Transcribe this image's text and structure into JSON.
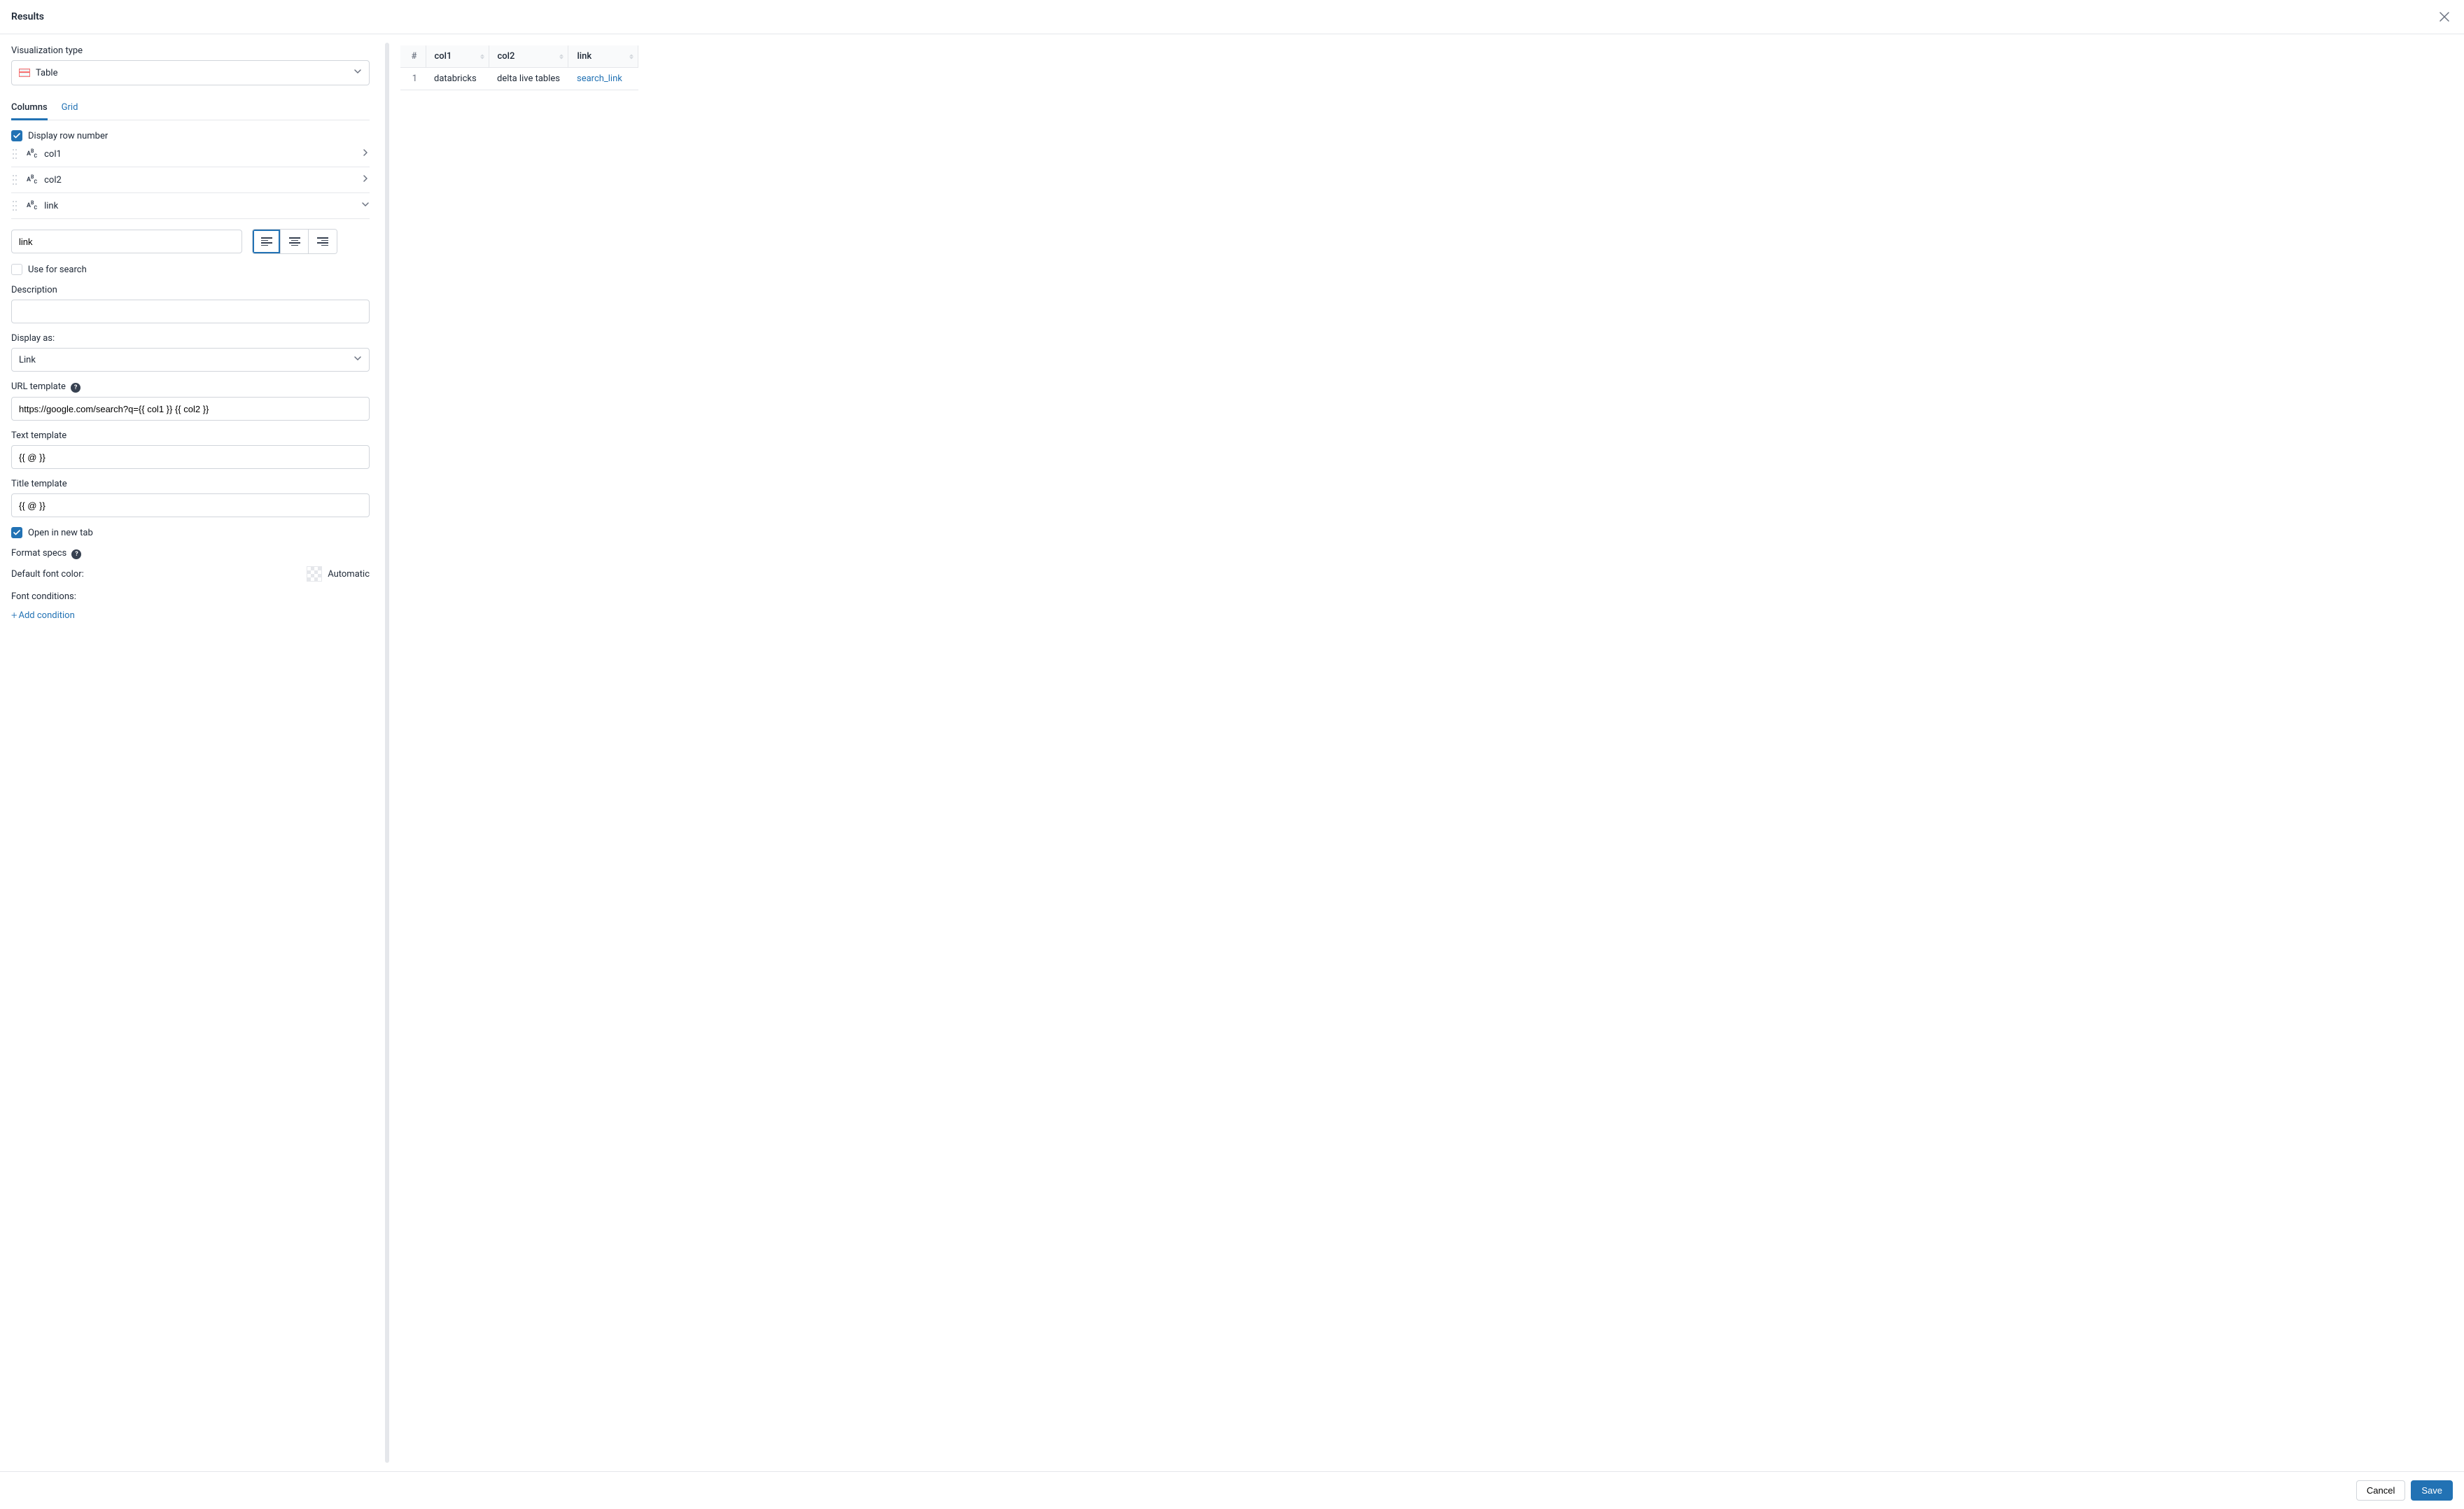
{
  "header": {
    "title": "Results"
  },
  "viz": {
    "label": "Visualization type",
    "value": "Table"
  },
  "tabs": {
    "columns": "Columns",
    "grid": "Grid",
    "active": "columns"
  },
  "displayRowNumber": {
    "label": "Display row number",
    "checked": true
  },
  "columns": [
    {
      "name": "col1",
      "expanded": false
    },
    {
      "name": "col2",
      "expanded": false
    },
    {
      "name": "link",
      "expanded": true
    }
  ],
  "linkConfig": {
    "nameInput": "link",
    "alignment": "left",
    "useForSearch": {
      "label": "Use for search",
      "checked": false
    },
    "descriptionLabel": "Description",
    "descriptionValue": "",
    "displayAsLabel": "Display as:",
    "displayAs": "Link",
    "urlTemplateLabel": "URL template",
    "urlTemplate": "https://google.com/search?q={{ col1 }} {{ col2 }}",
    "textTemplateLabel": "Text template",
    "textTemplate": "{{ @ }}",
    "titleTemplateLabel": "Title template",
    "titleTemplate": "{{ @ }}",
    "openNewTab": {
      "label": "Open in new tab",
      "checked": true
    },
    "formatSpecsLabel": "Format specs",
    "defaultFontColorLabel": "Default font color:",
    "defaultFontColorValue": "Automatic",
    "fontConditionsLabel": "Font conditions:",
    "addCondition": "Add condition"
  },
  "preview": {
    "headers": [
      "#",
      "col1",
      "col2",
      "link"
    ],
    "rows": [
      {
        "n": "1",
        "col1": "databricks",
        "col2": "delta live tables",
        "link": "search_link"
      }
    ]
  },
  "footer": {
    "cancel": "Cancel",
    "save": "Save"
  }
}
